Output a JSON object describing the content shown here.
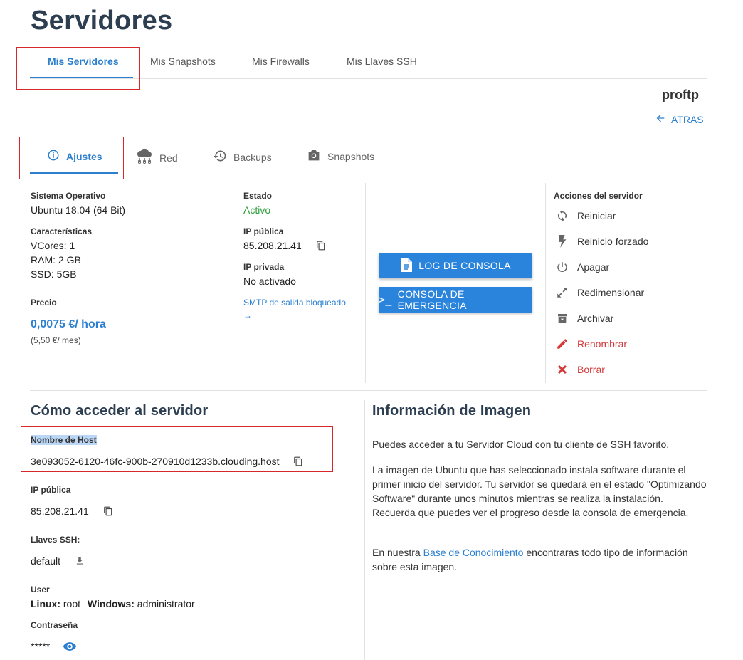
{
  "page": {
    "title": "Servidores"
  },
  "main_tabs": [
    {
      "label": "Mis Servidores"
    },
    {
      "label": "Mis Snapshots"
    },
    {
      "label": "Mis Firewalls"
    },
    {
      "label": "Mis Llaves SSH"
    }
  ],
  "server": {
    "name": "proftp",
    "back_label": "ATRAS"
  },
  "sub_tabs": [
    {
      "label": "Ajustes",
      "icon": "info-icon"
    },
    {
      "label": "Red",
      "icon": "cloud-network-icon"
    },
    {
      "label": "Backups",
      "icon": "history-icon"
    },
    {
      "label": "Snapshots",
      "icon": "camera-icon"
    }
  ],
  "details": {
    "os_label": "Sistema Operativo",
    "os_value": "Ubuntu 18.04 (64 Bit)",
    "features_label": "Características",
    "vcores": "VCores: 1",
    "ram": "RAM: 2 GB",
    "ssd": "SSD: 5GB",
    "price_label": "Precio",
    "price_hour": "0,0075 €/ hora",
    "price_month": "(5,50 €/ mes)",
    "status_label": "Estado",
    "status_value": "Activo",
    "public_ip_label": "IP pública",
    "public_ip_value": "85.208.21.41",
    "private_ip_label": "IP privada",
    "private_ip_value": "No activado",
    "smtp_link": "SMTP de salida bloqueado",
    "smtp_arrow": "→"
  },
  "buttons": {
    "console_log": "LOG DE CONSOLA",
    "emergency_console": "CONSOLA DE EMERGENCIA",
    "emergency_prefix": ">_"
  },
  "actions": {
    "title": "Acciones del servidor",
    "items": [
      {
        "label": "Reiniciar",
        "icon": "restart-icon"
      },
      {
        "label": "Reinicio forzado",
        "icon": "bolt-icon"
      },
      {
        "label": "Apagar",
        "icon": "power-icon"
      },
      {
        "label": "Redimensionar",
        "icon": "resize-icon"
      },
      {
        "label": "Archivar",
        "icon": "archive-icon"
      },
      {
        "label": "Renombrar",
        "icon": "pencil-icon"
      },
      {
        "label": "Borrar",
        "icon": "delete-x-icon"
      }
    ]
  },
  "access": {
    "title": "Cómo acceder al servidor",
    "hostname_label": "Nombre de Host",
    "hostname_value": "3e093052-6120-46fc-900b-270910d1233b.clouding.host",
    "public_ip_label": "IP pública",
    "public_ip_value": "85.208.21.41",
    "ssh_keys_label": "Llaves SSH:",
    "ssh_key_value": "default",
    "user_label": "User",
    "linux_label": "Linux:",
    "linux_user": "root",
    "windows_label": "Windows:",
    "windows_user": "administrator",
    "password_label": "Contraseña",
    "password_value": "*****"
  },
  "image_info": {
    "title": "Información de Imagen",
    "p1": "Puedes acceder a tu Servidor Cloud con tu cliente de SSH favorito.",
    "p2": "La imagen de Ubuntu que has seleccionado instala software durante el primer inicio del servidor. Tu servidor se quedará en el estado \"Optimizando Software\" durante unos minutos mientras se realiza la instalación. Recuerda que puedes ver el progreso desde la consola de emergencia.",
    "p3_before": "En nuestra ",
    "p3_link": "Base de Conocimiento",
    "p3_after": " encontraras todo tipo de información sobre esta imagen."
  },
  "colors": {
    "accent": "#2c7fcf",
    "active_green": "#2e9e3c",
    "danger": "#d33a3a",
    "highlight_box": "#d6282a"
  }
}
